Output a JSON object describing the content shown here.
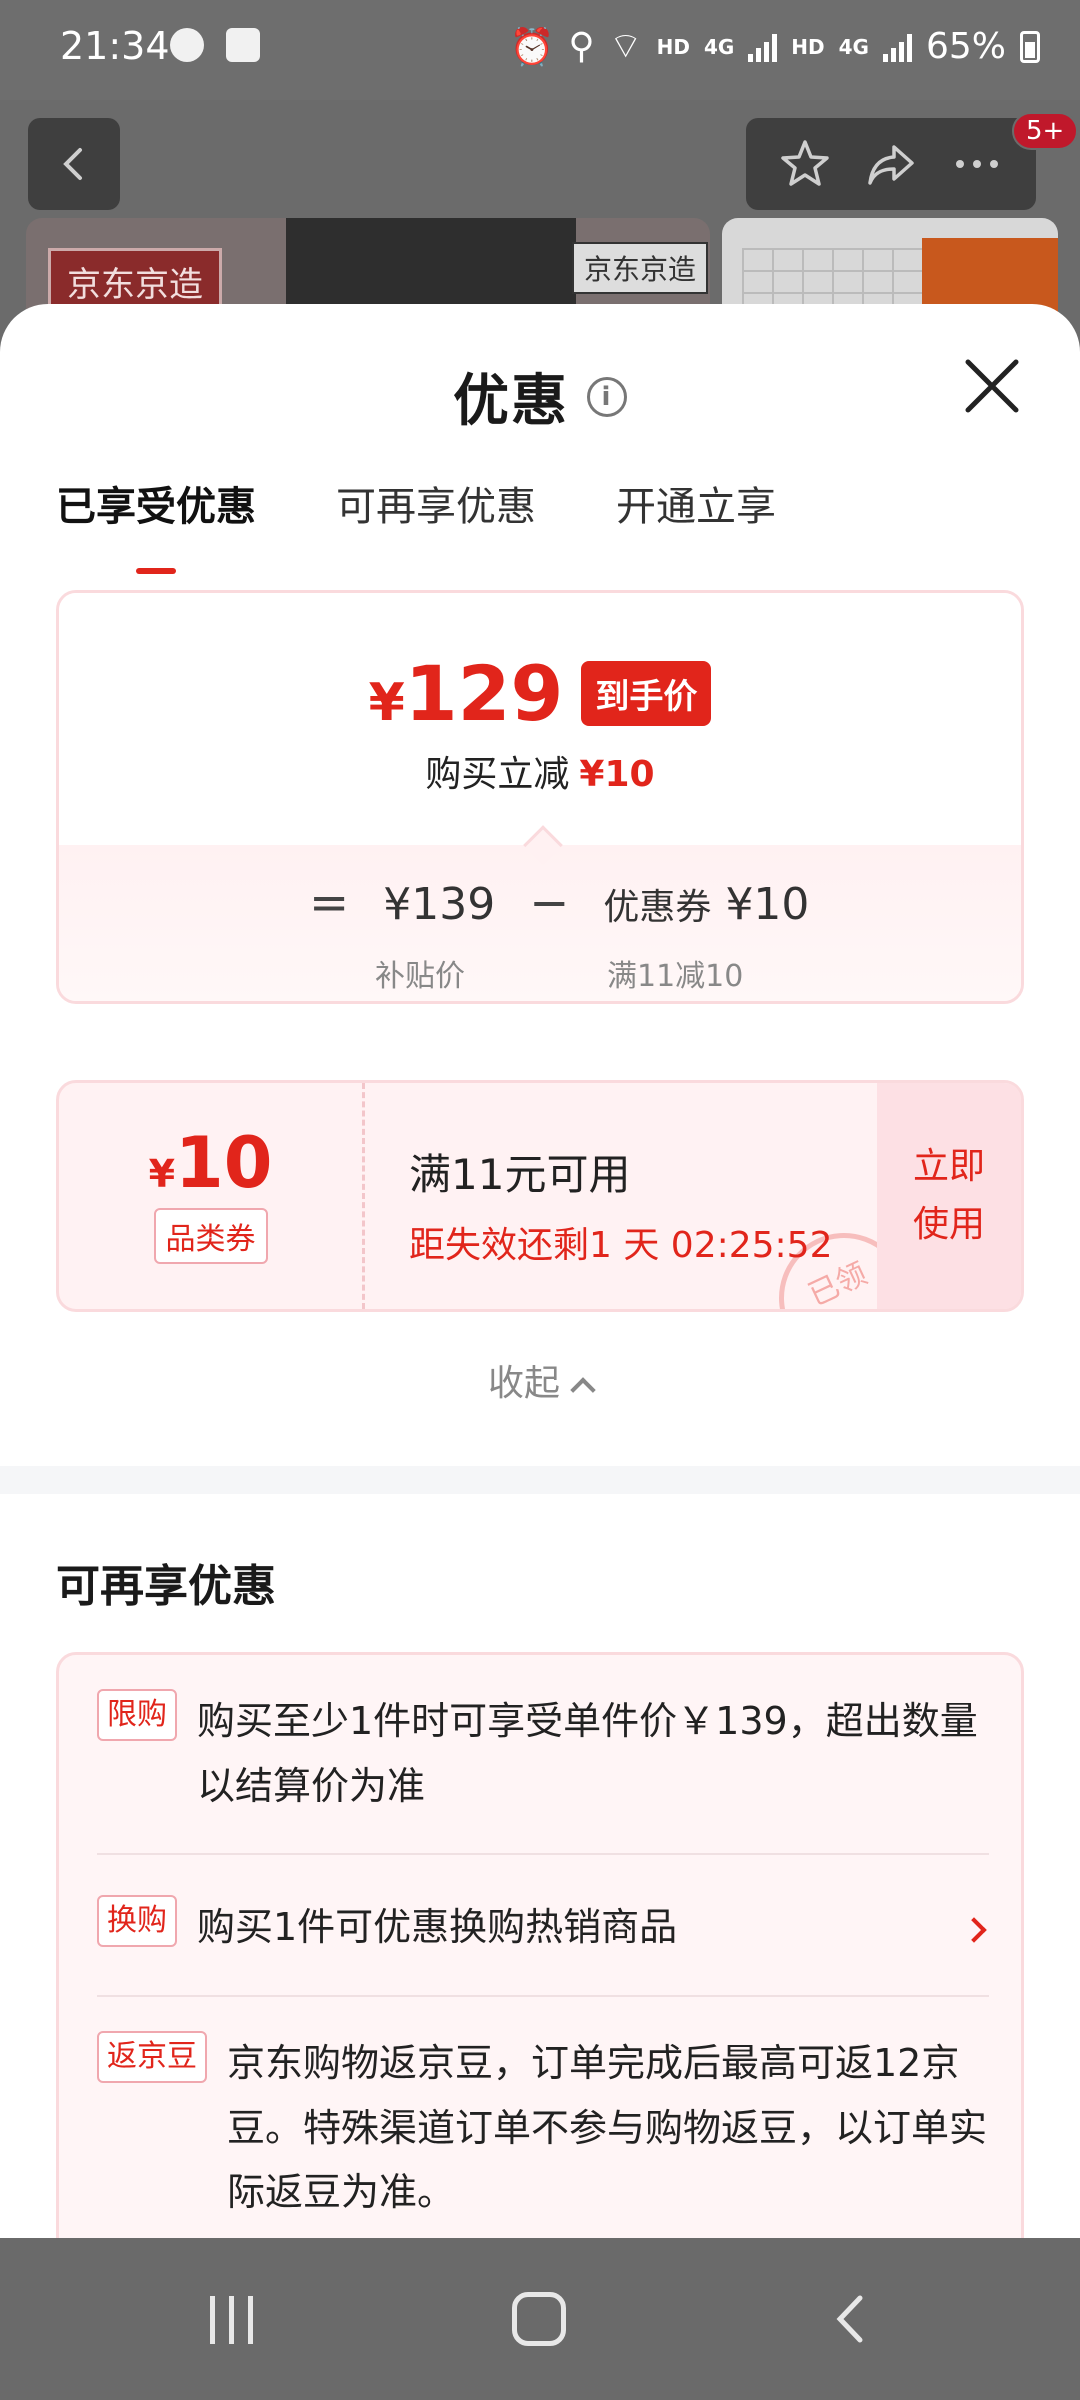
{
  "status_bar": {
    "time": "21:34",
    "hd1": "HD",
    "net1": "4G",
    "hd2": "HD",
    "net2": "4G",
    "battery": "65%"
  },
  "background_page": {
    "brand_tag_1": "京东京造",
    "brand_tag_2": "京东京造",
    "notification_count": "5+"
  },
  "sheet": {
    "title": "优惠",
    "info_symbol": "i"
  },
  "tabs": [
    {
      "label": "已享受优惠",
      "active": true
    },
    {
      "label": "可再享优惠",
      "active": false
    },
    {
      "label": "开通立享",
      "active": false
    }
  ],
  "price_card": {
    "currency": "¥",
    "final_price": "129",
    "final_tag": "到手价",
    "discount_label": "购买立减",
    "discount_value": "¥10",
    "calc": {
      "equals": "=",
      "base_price": "¥139",
      "minus": "−",
      "coupon_label": "优惠券",
      "coupon_value": "¥10",
      "base_caption": "补贴价",
      "coupon_caption": "满11减10"
    }
  },
  "coupon": {
    "currency": "¥",
    "amount": "10",
    "category": "品类券",
    "condition": "满11元可用",
    "expiry": "距失效还剩1 天 02:25:52",
    "use_line1": "立即",
    "use_line2": "使用",
    "stamp": "已领"
  },
  "collapse_label": "收起",
  "more_section": {
    "title": "可再享优惠",
    "items": [
      {
        "tag": "限购",
        "text": "购买至少1件时可享受单件价￥139，超出数量以结算价为准"
      },
      {
        "tag": "换购",
        "text": "购买1件可优惠换购热销商品"
      },
      {
        "tag": "返京豆",
        "text": "京东购物返京豆，订单完成后最高可返12京豆。特殊渠道订单不参与购物返豆，以订单实际返豆为准。"
      }
    ]
  },
  "colors": {
    "accent": "#e1251b",
    "card_border": "#fadadd",
    "card_bg": "#fff5f6"
  }
}
